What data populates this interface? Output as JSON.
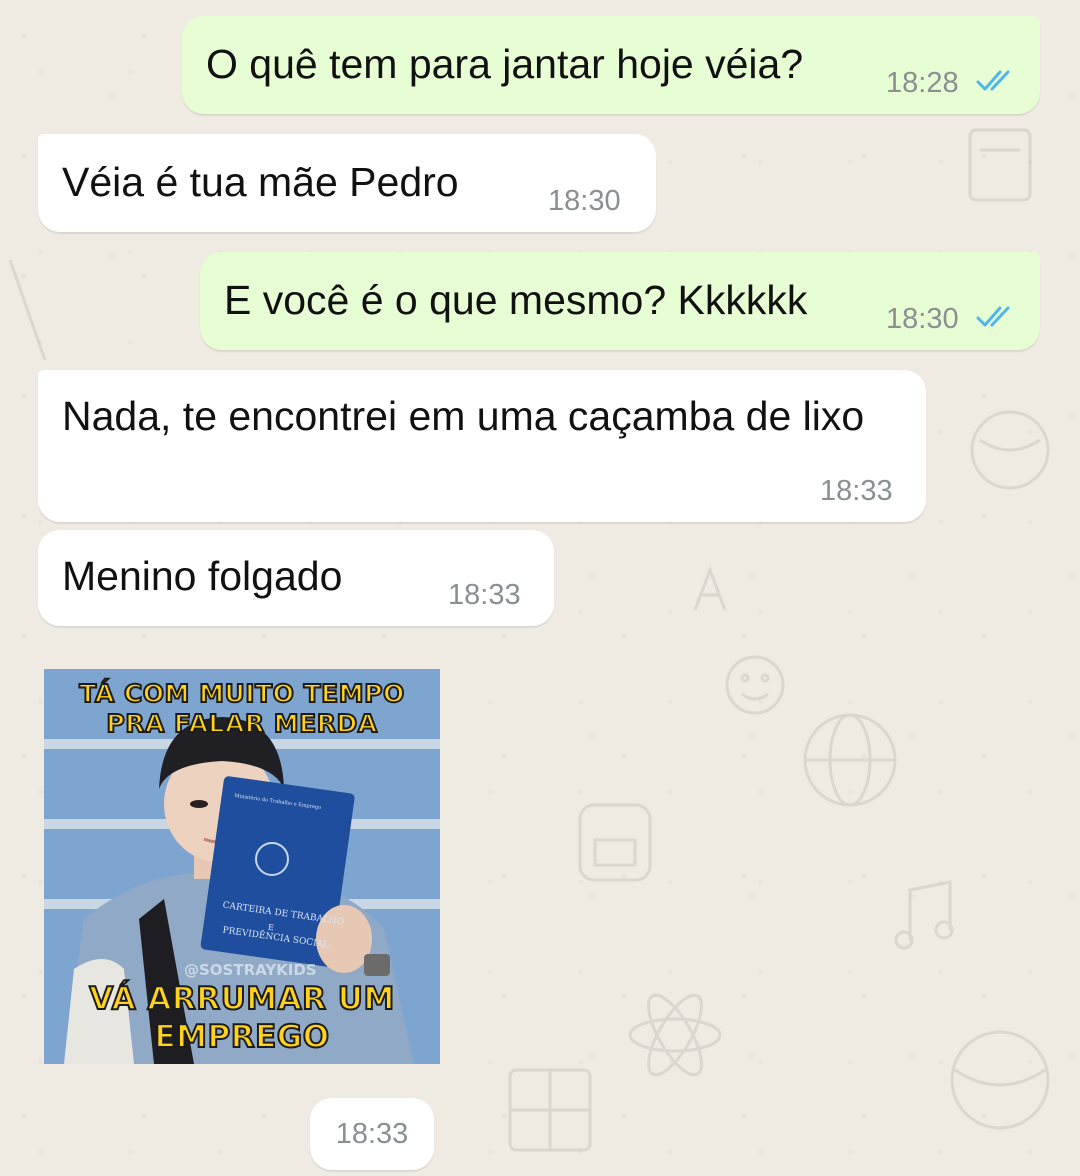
{
  "messages": [
    {
      "direction": "out",
      "text": "O quê tem para jantar hoje véia?",
      "time": "18:28",
      "status": "read"
    },
    {
      "direction": "in",
      "text": "Véia é tua mãe Pedro",
      "time": "18:30"
    },
    {
      "direction": "out",
      "text": "E você é o que mesmo? Kkkkkk",
      "time": "18:30",
      "status": "read"
    },
    {
      "direction": "in",
      "text": "Nada, te encontrei em uma caçamba de lixo",
      "time": "18:33"
    },
    {
      "direction": "in",
      "text": "Menino folgado",
      "time": "18:33"
    }
  ],
  "sticker": {
    "caption_top_line1": "TÁ COM MUITO TEMPO",
    "caption_top_line2": "PRA FALAR MERDA",
    "caption_bottom_line1": "VÁ ARRUMAR UM",
    "caption_bottom_line2": "EMPREGO",
    "watermark": "@SOSTRAYKIDS",
    "booklet_text_line1": "CARTEIRA DE TRABALHO",
    "booklet_text_line2": "E",
    "booklet_text_line3": "PREVIDÊNCIA SOCIAL",
    "booklet_header": "Ministério do Trabalho e Emprego",
    "time": "18:33"
  },
  "colors": {
    "outgoing_bubble": "#e7fdd4",
    "incoming_bubble": "#ffffff",
    "wallpaper": "#efeae2",
    "read_ticks": "#4fb6ec",
    "timestamp": "#8a8f91"
  },
  "icons": {
    "read_receipt": "double-check-icon"
  }
}
